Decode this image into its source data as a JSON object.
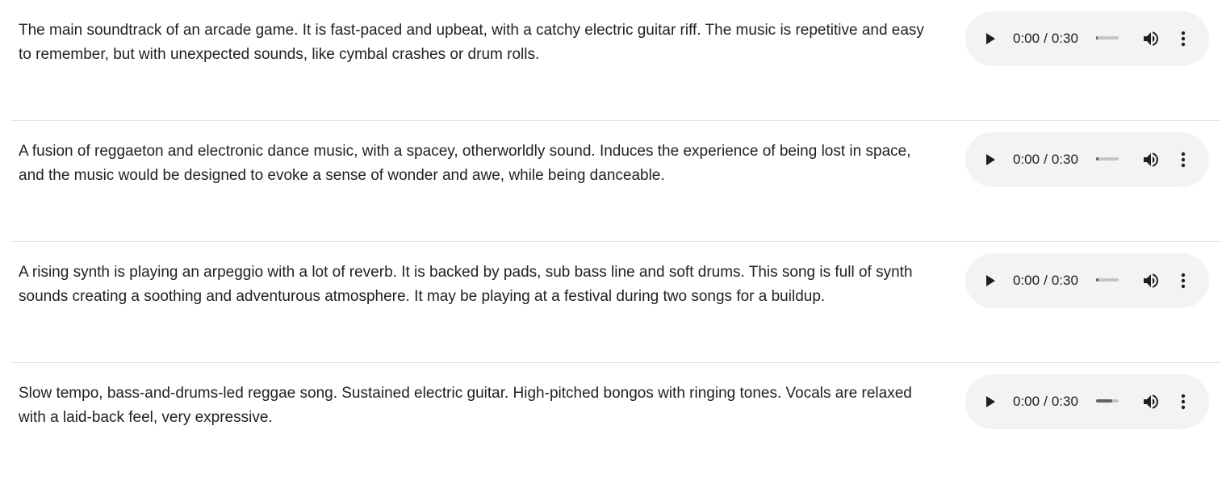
{
  "tracks": [
    {
      "description": "The main soundtrack of an arcade game. It is fast-paced and upbeat, with a catchy electric guitar riff. The music is repetitive and easy to remember, but with unexpected sounds, like cymbal crashes or drum rolls.",
      "current_time": "0:00",
      "duration": "0:30",
      "progress_fraction": 0.08
    },
    {
      "description": "A fusion of reggaeton and electronic dance music, with a spacey, otherworldly sound. Induces the experience of being lost in space, and the music would be designed to evoke a sense of wonder and awe, while being danceable.",
      "current_time": "0:00",
      "duration": "0:30",
      "progress_fraction": 0.12
    },
    {
      "description": "A rising synth is playing an arpeggio with a lot of reverb. It is backed by pads, sub bass line and soft drums. This song is full of synth sounds creating a soothing and adventurous atmosphere. It may be playing at a festival during two songs for a buildup.",
      "current_time": "0:00",
      "duration": "0:30",
      "progress_fraction": 0.12
    },
    {
      "description": "Slow tempo, bass-and-drums-led reggae song. Sustained electric guitar. High-pitched bongos with ringing tones. Vocals are relaxed with a laid-back feel, very expressive.",
      "current_time": "0:00",
      "duration": "0:30",
      "progress_fraction": 0.7
    }
  ],
  "player": {
    "time_separator": "/",
    "play_icon": "play-icon",
    "volume_icon": "volume-icon",
    "more_icon": "more-vertical-icon"
  },
  "colors": {
    "player_background": "#f1f3f4",
    "icon": "#1f1f1f",
    "progress_track": "#c3c6c9",
    "progress_fill": "#5f6368",
    "divider": "#e3e3e3"
  }
}
